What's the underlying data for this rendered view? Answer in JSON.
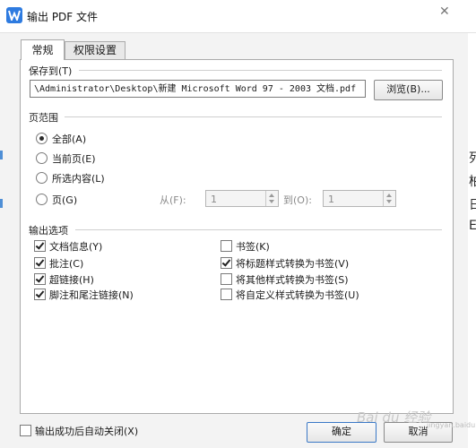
{
  "window": {
    "title": "输出 PDF 文件",
    "close_glyph": "✕",
    "icon": "wps-writer-icon",
    "accent": "#2e7be0"
  },
  "tabs": [
    {
      "label": "常规",
      "active": true
    },
    {
      "label": "权限设置",
      "active": false
    }
  ],
  "save_to": {
    "label": "保存到(T)",
    "path": "\\Administrator\\Desktop\\新建 Microsoft Word 97 - 2003 文档.pdf",
    "browse_label": "浏览(B)..."
  },
  "page_range": {
    "label": "页范围",
    "options": [
      {
        "label": "全部(A)",
        "selected": true
      },
      {
        "label": "当前页(E)",
        "selected": false
      },
      {
        "label": "所选内容(L)",
        "selected": false
      },
      {
        "label": "页(G)",
        "selected": false
      }
    ],
    "from_label": "从(F):",
    "from_value": "1",
    "to_label": "到(O):",
    "to_value": "1"
  },
  "output_options": {
    "label": "输出选项",
    "left": [
      {
        "label": "文档信息(Y)",
        "checked": true
      },
      {
        "label": "批注(C)",
        "checked": true
      },
      {
        "label": "超链接(H)",
        "checked": true
      },
      {
        "label": "脚注和尾注链接(N)",
        "checked": true
      }
    ],
    "right": [
      {
        "label": "书签(K)",
        "checked": false
      },
      {
        "label": "将标题样式转换为书签(V)",
        "checked": true
      },
      {
        "label": "将其他样式转换为书签(S)",
        "checked": false
      },
      {
        "label": "将自定义样式转换为书签(U)",
        "checked": false
      }
    ]
  },
  "footer": {
    "auto_close_label": "输出成功后自动关闭(X)",
    "auto_close_checked": false,
    "ok_label": "确定",
    "cancel_label": "取消"
  },
  "background": {
    "glyphs": [
      "列",
      "柏",
      "日",
      "E"
    ],
    "watermark": "Bai du 经验",
    "watermark_sub": "jingyan.baidu.com"
  }
}
